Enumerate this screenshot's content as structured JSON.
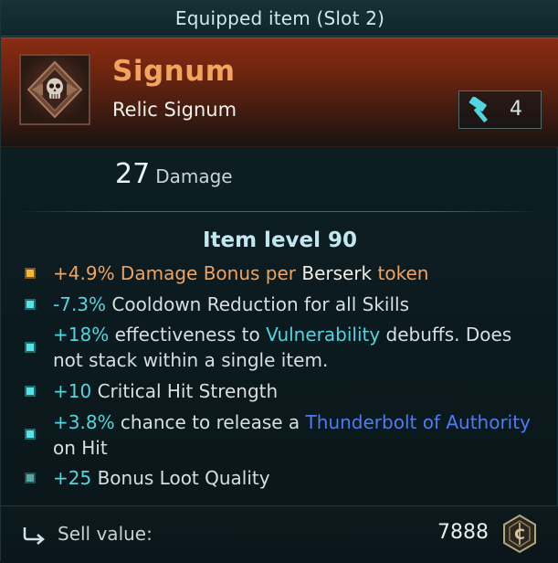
{
  "header_bar": {
    "title": "Equipped item (Slot 2)"
  },
  "item": {
    "name": "Signum",
    "type": "Relic Signum",
    "icon": "skull-crest-icon",
    "slot_count": "4",
    "slot_icon": "hammer-icon",
    "damage_value": "27",
    "damage_label": "Damage",
    "level_text": "Item level 90"
  },
  "affixes": [
    {
      "bullet": "gold",
      "parts": [
        {
          "text": "+4.9%",
          "style": "gold"
        },
        {
          "text": " Damage Bonus per ",
          "style": "gold"
        },
        {
          "text": "Berserk",
          "style": "white"
        },
        {
          "text": " token",
          "style": "gold"
        }
      ]
    },
    {
      "bullet": "cyan",
      "parts": [
        {
          "text": "-7.3%",
          "style": "num"
        },
        {
          "text": " Cooldown Reduction for all Skills",
          "style": "plain"
        }
      ]
    },
    {
      "bullet": "cyan",
      "parts": [
        {
          "text": "+18%",
          "style": "num"
        },
        {
          "text": " effectiveness to ",
          "style": "plain"
        },
        {
          "text": "Vulnerability",
          "style": "cyan"
        },
        {
          "text": " debuffs. Does not stack within a single item.",
          "style": "plain"
        }
      ]
    },
    {
      "bullet": "cyan",
      "parts": [
        {
          "text": "+10",
          "style": "num"
        },
        {
          "text": " Critical Hit Strength",
          "style": "plain"
        }
      ]
    },
    {
      "bullet": "cyan",
      "parts": [
        {
          "text": "+3.8%",
          "style": "num"
        },
        {
          "text": " chance to release a ",
          "style": "plain"
        },
        {
          "text": "Thunderbolt of Authority",
          "style": "blue"
        },
        {
          "text": " on Hit",
          "style": "plain"
        }
      ]
    },
    {
      "bullet": "teal",
      "parts": [
        {
          "text": "+25",
          "style": "num"
        },
        {
          "text": " Bonus Loot Quality",
          "style": "plain"
        }
      ]
    }
  ],
  "footer": {
    "sell_label": "Sell value:",
    "sell_value": "7888",
    "sell_icon": "return-arrow-icon",
    "currency_icon": "coin-icon"
  },
  "colors": {
    "legendary_name": "#f2a35c",
    "number": "#4fd6df",
    "keyword_blue": "#4c7df0",
    "bullet_gold": "#f4b736",
    "bullet_cyan": "#56e3e6"
  }
}
